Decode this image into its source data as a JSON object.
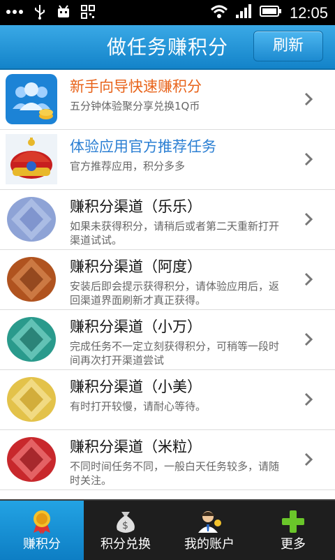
{
  "status": {
    "time": "12:05"
  },
  "header": {
    "title": "做任务赚积分",
    "refresh_label": "刷新"
  },
  "items": [
    {
      "title": "新手向导快速赚积分",
      "desc": "五分钟体验聚分享兑换1Q币",
      "icon": "users-coins-icon"
    },
    {
      "title": "体验应用官方推荐任务",
      "desc": "官方推荐应用，积分多多",
      "icon": "crown-icon"
    },
    {
      "title": "赚积分渠道（乐乐）",
      "desc": "如果未获得积分，请稍后或者第二天重新打开渠道试试。",
      "icon": "gem-blue-icon",
      "color": "#8ea3d6"
    },
    {
      "title": "赚积分渠道（阿度）",
      "desc": "安装后即会提示获得积分，请体验应用后，返回渠道界面刷新才真正获得。",
      "icon": "gem-brown-icon",
      "color": "#b0531f"
    },
    {
      "title": "赚积分渠道（小万）",
      "desc": "完成任务不一定立刻获得积分，可稍等一段时间再次打开渠道尝试",
      "icon": "gem-teal-icon",
      "color": "#2a9a8c"
    },
    {
      "title": "赚积分渠道（小美）",
      "desc": "有时打开较慢，请耐心等待。",
      "icon": "gem-yellow-icon",
      "color": "#e3c24a"
    },
    {
      "title": "赚积分渠道（米粒）",
      "desc": "不同时间任务不同，一般白天任务较多，请随时关注。",
      "icon": "gem-red-icon",
      "color": "#c8282c"
    }
  ],
  "tabs": [
    {
      "label": "赚积分",
      "icon": "award-icon"
    },
    {
      "label": "积分兑换",
      "icon": "money-bag-icon"
    },
    {
      "label": "我的账户",
      "icon": "account-icon"
    },
    {
      "label": "更多",
      "icon": "plus-icon"
    }
  ]
}
